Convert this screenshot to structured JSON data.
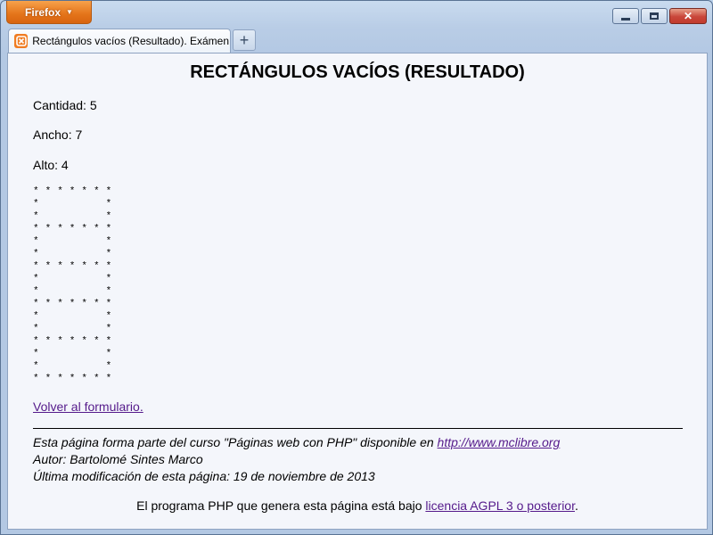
{
  "browser": {
    "menu_label": "Firefox",
    "tab_title": "Rectángulos vacíos (Resultado). Exámen…",
    "new_tab_label": "+",
    "accent": "#e4741a"
  },
  "page": {
    "heading": "RECTÁNGULOS VACÍOS (RESULTADO)",
    "cantidad": "Cantidad: 5",
    "ancho": "Ancho: 7",
    "alto": "Alto: 4",
    "rect_lines": [
      "* * * * * * *",
      "*           *",
      "*           *",
      "* * * * * * *",
      "*           *",
      "*           *",
      "* * * * * * *",
      "*           *",
      "*           *",
      "* * * * * * *",
      "*           *",
      "*           *",
      "* * * * * * *",
      "*           *",
      "*           *",
      "* * * * * * *"
    ],
    "back_link": "Volver al formulario.",
    "footer": {
      "course_prefix": "Esta página forma parte del curso \"Páginas web con PHP\" disponible en ",
      "course_link": "http://www.mclibre.org",
      "author": "Autor: Bartolomé Sintes Marco",
      "modified": "Última modificación de esta página: 19 de noviembre de 2013"
    },
    "license": {
      "prefix": "El programa PHP que genera esta página está bajo ",
      "link": "licencia AGPL 3 o posterior",
      "suffix": "."
    },
    "link_color": "#551a8b"
  }
}
